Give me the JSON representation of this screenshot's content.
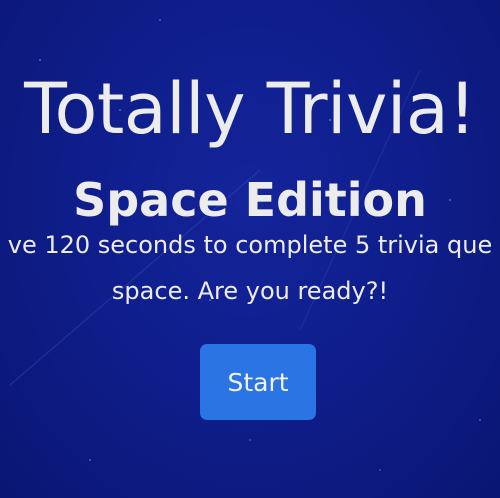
{
  "header": {
    "title": "Totally Trivia!",
    "subtitle": "Space Edition"
  },
  "intro": {
    "line1": "ve 120 seconds to complete 5 trivia que",
    "line2": "space. Are you ready?!"
  },
  "controls": {
    "start_label": "Start"
  },
  "colors": {
    "background": "#0d1b83",
    "button": "#2b74e3",
    "text": "#ececec"
  }
}
